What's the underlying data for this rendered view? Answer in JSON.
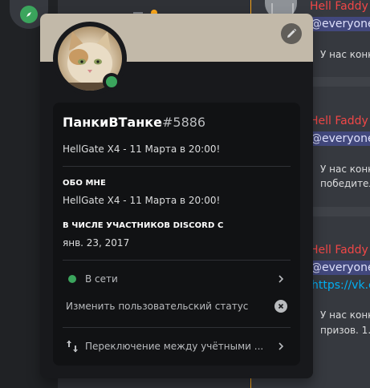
{
  "profile": {
    "username": "ПанкиВТанке",
    "discriminator": "#5886",
    "custom_status": "HellGate X4 - 11 Марта в 20:00!",
    "status_color": "#3ba55d",
    "banner_color": "#c2b9a9"
  },
  "about": {
    "heading": "ОБО МНЕ",
    "text": "HellGate X4 - 11 Марта в 20:00!"
  },
  "member_since": {
    "heading": "В ЧИСЛЕ УЧАСТНИКОВ DISCORD С",
    "date": "янв. 23, 2017"
  },
  "menu": {
    "status_label": "В сети",
    "edit_status_label": "Изменить пользовательский статус",
    "switch_accounts_label": "Переключение между учётными ..."
  },
  "background_chat": {
    "author": "Hell Faddy",
    "mention": "@everyone",
    "line_intro": "У нас конк",
    "line_winner": "победител",
    "link": "https://vk.co",
    "line_prizes": "призов. 1."
  },
  "icons": {
    "explore": "compass-icon",
    "edit": "pencil-icon",
    "chevron": "chevron-right-icon",
    "clear": "clear-x-icon",
    "switch": "switch-accounts-icon"
  }
}
